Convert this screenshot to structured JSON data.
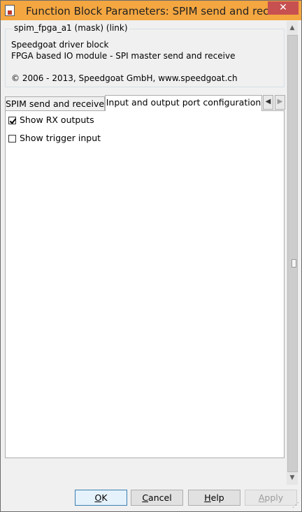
{
  "window": {
    "title": "Function Block Parameters: SPIM send and receive",
    "close_glyph": "✕"
  },
  "groupbox": {
    "legend": "spim_fpga_a1 (mask) (link)",
    "line1": "Speedgoat driver block",
    "line2": "FPGA based IO module - SPI master send and receive",
    "line3": "© 2006 - 2013, Speedgoat GmbH, www.speedgoat.ch"
  },
  "tabs": [
    {
      "label": "SPIM send and receive",
      "active": false
    },
    {
      "label": "Input and output port configuration",
      "active": true
    }
  ],
  "tab_scroll": {
    "left": "◀",
    "right": "▶"
  },
  "checkboxes": [
    {
      "label": "Show RX outputs",
      "checked": true
    },
    {
      "label": "Show trigger input",
      "checked": false
    }
  ],
  "scrollbar": {
    "up": "▲",
    "down": "▼"
  },
  "buttons": {
    "ok": {
      "mnemonic": "O",
      "rest": "K"
    },
    "cancel": {
      "mnemonic": "C",
      "rest": "ancel"
    },
    "help": {
      "mnemonic": "H",
      "rest": "elp"
    },
    "apply": {
      "mnemonic": "A",
      "rest": "pply",
      "enabled": false
    }
  },
  "colors": {
    "titlebar": "#f4a640",
    "close": "#c75050"
  }
}
